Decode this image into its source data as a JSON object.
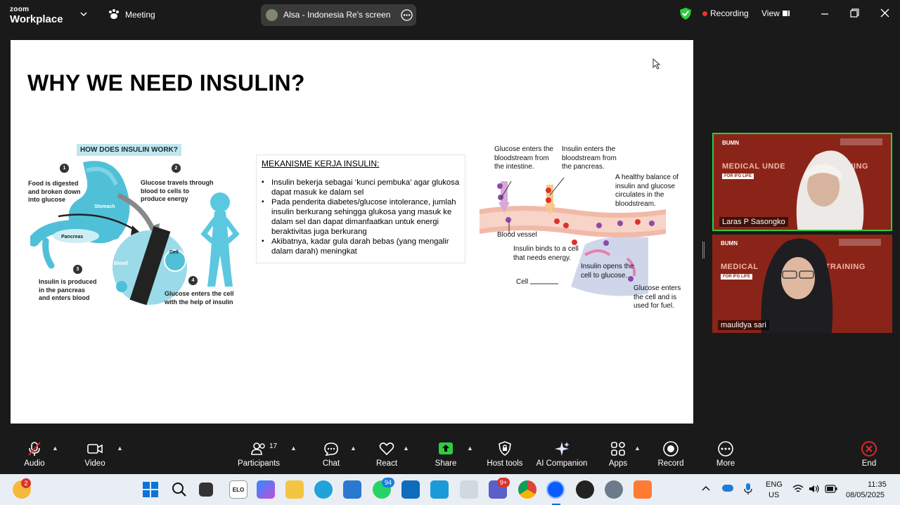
{
  "app": {
    "brand_top": "zoom",
    "brand_bottom": "Workplace"
  },
  "topbar": {
    "meeting_label": "Meeting",
    "share_label": "Alsa - Indonesia Re's screen",
    "recording_label": "Recording",
    "view_label": "View"
  },
  "slide": {
    "title": "WHY WE NEED INSULIN?",
    "diagram1": {
      "heading": "HOW DOES INSULIN WORK?",
      "step1": "Food is digested\nand broken down\ninto glucose",
      "step2": "Glucose travels through\nblood to cells to\nproduce energy",
      "step3": "Insulin is produced\nin the pancreas\nand enters blood",
      "step4": "Glucose enters the cell\nwith the help of insulin",
      "n1": "1",
      "n2": "2",
      "n3": "3",
      "n4": "4",
      "stomach": "Stomach",
      "pancreas": "Pancreas",
      "blood": "Blood",
      "cell": "Cell"
    },
    "mechanism": {
      "heading": "MEKANISME KERJA INSULIN:",
      "items": [
        "Insulin bekerja sebagai ‘kunci pembuka’ agar glukosa dapat masuk ke dalam sel",
        "Pada penderita diabetes/glucose intolerance, jumlah insulin berkurang sehingga glukosa yang masuk ke dalam sel dan dapat dimanfaatkan untuk energi beraktivitas juga berkurang",
        "Akibatnya, kadar gula darah bebas (yang mengalir dalam darah) meningkat"
      ]
    },
    "diagram2": {
      "glucose_enters": "Glucose enters the\nbloodstream from\nthe intestine.",
      "insulin_enters": "Insulin enters the\nbloodstream from\nthe pancreas.",
      "balance": "A healthy balance of\ninsulin and glucose\ncirculates in the\nbloodstream.",
      "blood_vessel": "Blood vessel",
      "binds": "Insulin binds to a cell\nthat needs energy.",
      "opens": "Insulin opens the\ncell to glucose.",
      "cell": "Cell",
      "glucose_cell": "Glucose enters\nthe cell and is\nused for fuel."
    }
  },
  "participants_video": [
    {
      "name": "Laras P Sasongko",
      "banner": "MEDICAL UNDE",
      "banner2": "RAINING",
      "tag": "FOR IFG LIFE",
      "active": true
    },
    {
      "name": "maulidya sari",
      "banner": "MEDICAL",
      "banner2": "O TRAINING",
      "tag": "FOR IFG LIFE",
      "active": false
    }
  ],
  "toolbar": {
    "audio": "Audio",
    "video": "Video",
    "participants": "Participants",
    "participants_count": "17",
    "chat": "Chat",
    "react": "React",
    "share": "Share",
    "host_tools": "Host tools",
    "ai_companion": "AI Companion",
    "apps": "Apps",
    "record": "Record",
    "more": "More",
    "end": "End"
  },
  "taskbar": {
    "weather_badge": "2",
    "whatsapp_badge": "94",
    "teams_badge": "9+",
    "lang1": "ENG",
    "lang2": "US",
    "time": "11:35",
    "date": "08/05/2025",
    "elo_label": "ELO"
  },
  "colors": {
    "accent_green": "#2ecc40",
    "slide_bg": "#ffffff",
    "stomach_teal": "#4fc0d8",
    "tile_red": "#8b2418",
    "end_red": "#e0252c"
  }
}
